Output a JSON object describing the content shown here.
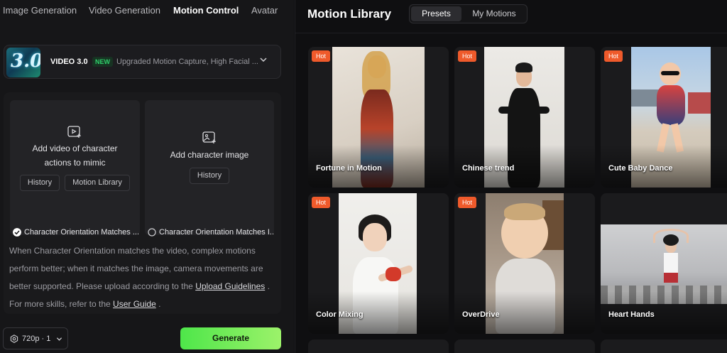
{
  "nav": {
    "tabs": [
      {
        "label": "Image Generation",
        "active": false
      },
      {
        "label": "Video Generation",
        "active": false
      },
      {
        "label": "Motion Control",
        "active": true
      },
      {
        "label": "Avatar",
        "active": false
      }
    ]
  },
  "model": {
    "thumb_text": "3.0",
    "name": "VIDEO 3.0",
    "badge": "NEW",
    "description": "Upgraded Motion Capture, High Facial ...",
    "icon": "chevron-down-icon"
  },
  "upload": {
    "video_card": {
      "icon": "video-add-icon",
      "label_line1": "Add video of character",
      "label_line2": "actions to mimic",
      "history_label": "History",
      "library_label": "Motion Library",
      "orientation_label": "Character Orientation Matches ..."
    },
    "image_card": {
      "icon": "image-add-icon",
      "label": "Add character image",
      "history_label": "History",
      "orientation_label": "Character Orientation Matches I..."
    },
    "note": {
      "text1": "When Character Orientation matches the video, complex motions perform better; when it matches the image, camera movements are better supported. Please upload according to the ",
      "link1": "Upload Guidelines",
      "text2": " . For more skills, refer to the ",
      "link2": "User Guide",
      "text3": " ."
    }
  },
  "footer": {
    "quality": "720p · 1",
    "generate_label": "Generate"
  },
  "library": {
    "title": "Motion Library",
    "tabs": [
      {
        "label": "Presets",
        "active": true
      },
      {
        "label": "My Motions",
        "active": false
      }
    ],
    "items": [
      {
        "caption": "Fortune in Motion",
        "hot": "Hot"
      },
      {
        "caption": "Chinese trend",
        "hot": "Hot"
      },
      {
        "caption": "Cute Baby Dance",
        "hot": "Hot"
      },
      {
        "caption": "Color Mixing",
        "hot": "Hot"
      },
      {
        "caption": "OverDrive",
        "hot": "Hot"
      },
      {
        "caption": "Heart Hands",
        "hot": ""
      }
    ]
  },
  "colors": {
    "accent_green": "#4ee64a",
    "hot_badge": "#ef5a2b",
    "new_badge": "#2fd06b"
  }
}
